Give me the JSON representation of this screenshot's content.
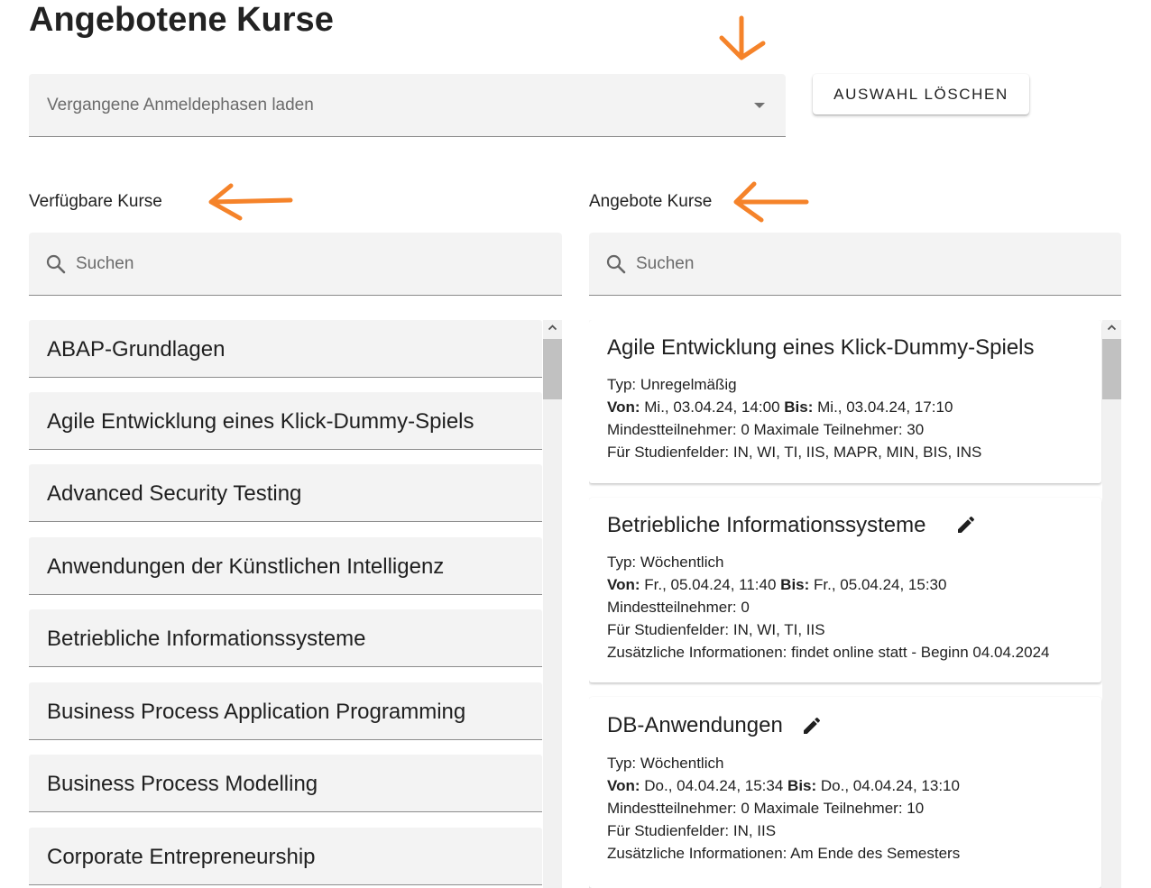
{
  "page_title": "Angebotene Kurse",
  "phase_select": {
    "placeholder": "Vergangene Anmeldephasen laden"
  },
  "clear_button": "AUSWAHL LÖSCHEN",
  "available": {
    "label": "Verfügbare Kurse",
    "search_placeholder": "Suchen",
    "items": [
      "ABAP-Grundlagen",
      "Agile Entwicklung eines Klick-Dummy-Spiels",
      "Advanced Security Testing",
      "Anwendungen der Künstlichen Intelligenz",
      "Betriebliche Informationssysteme",
      "Business Process Application Programming",
      "Business Process Modelling",
      "Corporate Entrepreneurship"
    ]
  },
  "offered": {
    "label": "Angebote Kurse",
    "search_placeholder": "Suchen",
    "von_label": "Von:",
    "bis_label": "Bis:",
    "cards": [
      {
        "title": "Agile Entwicklung eines Klick-Dummy-Spiels",
        "typ": "Typ: Unregelmäßig",
        "von": "Mi., 03.04.24, 14:00",
        "bis": "Mi., 03.04.24, 17:10",
        "teilnehmer": "Mindestteilnehmer: 0 Maximale Teilnehmer: 30",
        "studienfelder": "Für Studienfelder: IN, WI, TI, IIS, MAPR, MIN, BIS, INS",
        "info": ""
      },
      {
        "title": "Betriebliche Informationssysteme",
        "typ": "Typ: Wöchentlich",
        "von": "Fr., 05.04.24, 11:40",
        "bis": "Fr., 05.04.24, 15:30",
        "teilnehmer": "Mindestteilnehmer: 0",
        "studienfelder": "Für Studienfelder: IN, WI, TI, IIS",
        "info": "Zusätzliche Informationen: findet online statt - Beginn 04.04.2024"
      },
      {
        "title": "DB-Anwendungen",
        "typ": "Typ: Wöchentlich",
        "von": "Do., 04.04.24, 15:34",
        "bis": "Do., 04.04.24, 13:10",
        "teilnehmer": "Mindestteilnehmer: 0 Maximale Teilnehmer: 10",
        "studienfelder": "Für Studienfelder: IN, IIS",
        "info": "Zusätzliche Informationen: Am Ende des Semesters"
      }
    ]
  },
  "annotation_color": "#f5832a",
  "icons": {
    "search": "search-icon",
    "edit": "pencil-icon",
    "dropdown": "caret-down-icon",
    "scroll_up": "chevron-up-icon",
    "annotation": "orange-arrow"
  }
}
